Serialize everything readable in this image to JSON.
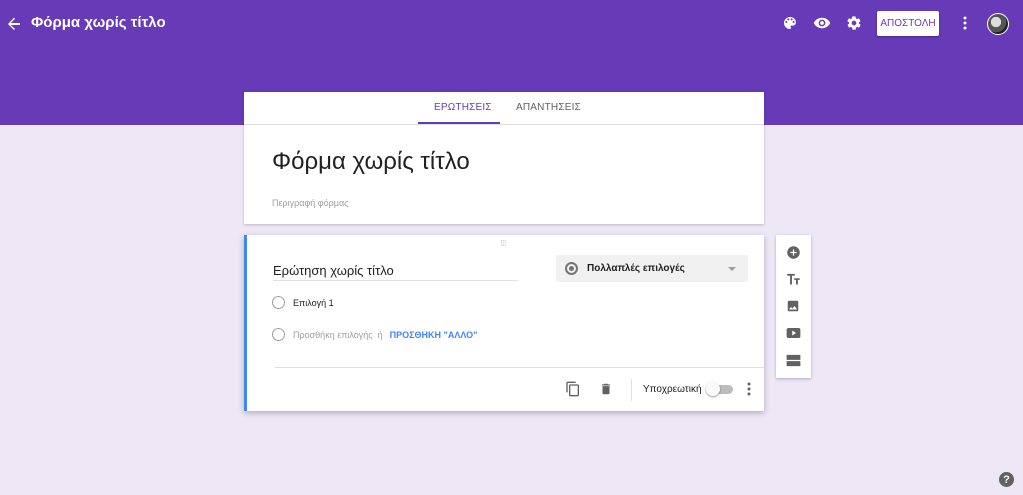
{
  "header": {
    "title": "Φόρμα χωρίς τίτλο",
    "send_label": "ΑΠΟΣΤΟΛΗ",
    "icons": [
      "back-arrow-icon",
      "palette-icon",
      "eye-icon",
      "gear-icon",
      "more-vert-icon"
    ]
  },
  "tabs": [
    {
      "label": "ΕΡΩΤΗΣΕΙΣ",
      "active": true
    },
    {
      "label": "ΑΠΑΝΤΗΣΕΙΣ",
      "active": false
    }
  ],
  "form": {
    "title": "Φόρμα χωρίς τίτλο",
    "description_placeholder": "Περιγραφή φόρμας"
  },
  "question": {
    "title": "Ερώτηση χωρίς τίτλο",
    "type_label": "Πολλαπλές επιλογές",
    "options": [
      {
        "label": "Επιλογή 1"
      }
    ],
    "add_option": "Προσθήκη επιλογής",
    "or_text": "ή",
    "add_other": "ΠΡΟΣΘΗΚΗ \"ΑΛΛΟ\"",
    "required_label": "Υποχρεωτική",
    "required": false
  },
  "toolbar": {
    "items": [
      "add-question-icon",
      "title-text-icon",
      "image-icon",
      "video-icon",
      "section-icon"
    ]
  },
  "colors": {
    "header": "#673ab7",
    "background": "#ede7f6",
    "accent": "#4285f4"
  },
  "help": {
    "glyph": "?"
  }
}
